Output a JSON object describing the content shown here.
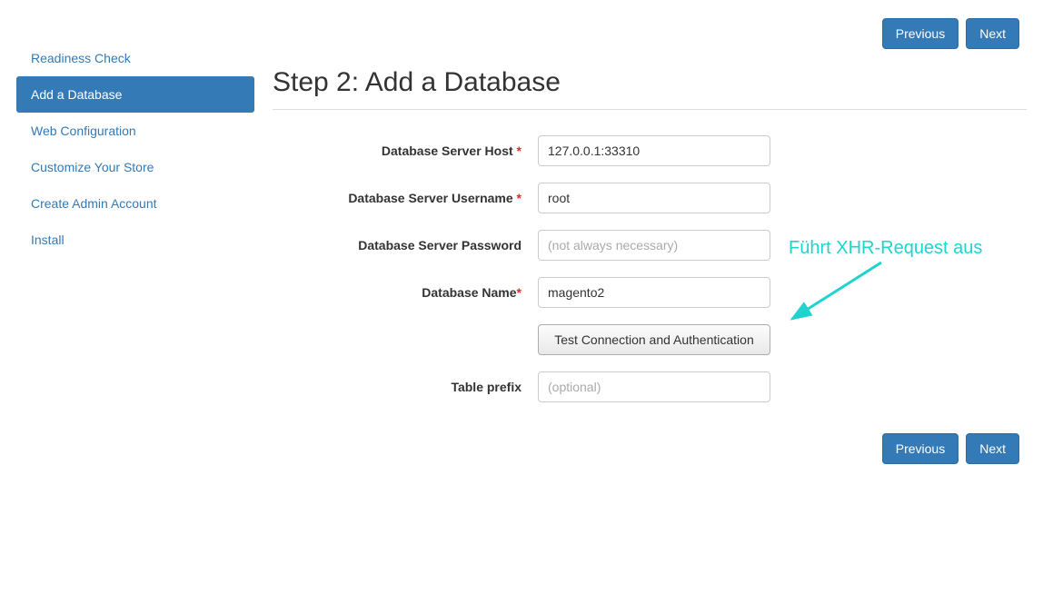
{
  "sidebar": {
    "items": [
      {
        "label": "Readiness Check",
        "active": false
      },
      {
        "label": "Add a Database",
        "active": true
      },
      {
        "label": "Web Configuration",
        "active": false
      },
      {
        "label": "Customize Your Store",
        "active": false
      },
      {
        "label": "Create Admin Account",
        "active": false
      },
      {
        "label": "Install",
        "active": false
      }
    ]
  },
  "header": {
    "previous": "Previous",
    "next": "Next"
  },
  "page": {
    "title": "Step 2: Add a Database"
  },
  "form": {
    "host": {
      "label": "Database Server Host ",
      "required": "*",
      "value": "127.0.0.1:33310"
    },
    "username": {
      "label": "Database Server Username ",
      "required": "*",
      "value": "root"
    },
    "password": {
      "label": "Database Server Password",
      "placeholder": "(not always necessary)",
      "value": ""
    },
    "dbname": {
      "label": "Database Name",
      "required": "*",
      "value": "magento2"
    },
    "test_button": "Test Connection and Authentication",
    "prefix": {
      "label": "Table prefix",
      "placeholder": "(optional)",
      "value": ""
    }
  },
  "annotation": {
    "text": "Führt XHR-Request aus"
  },
  "footer": {
    "previous": "Previous",
    "next": "Next"
  }
}
